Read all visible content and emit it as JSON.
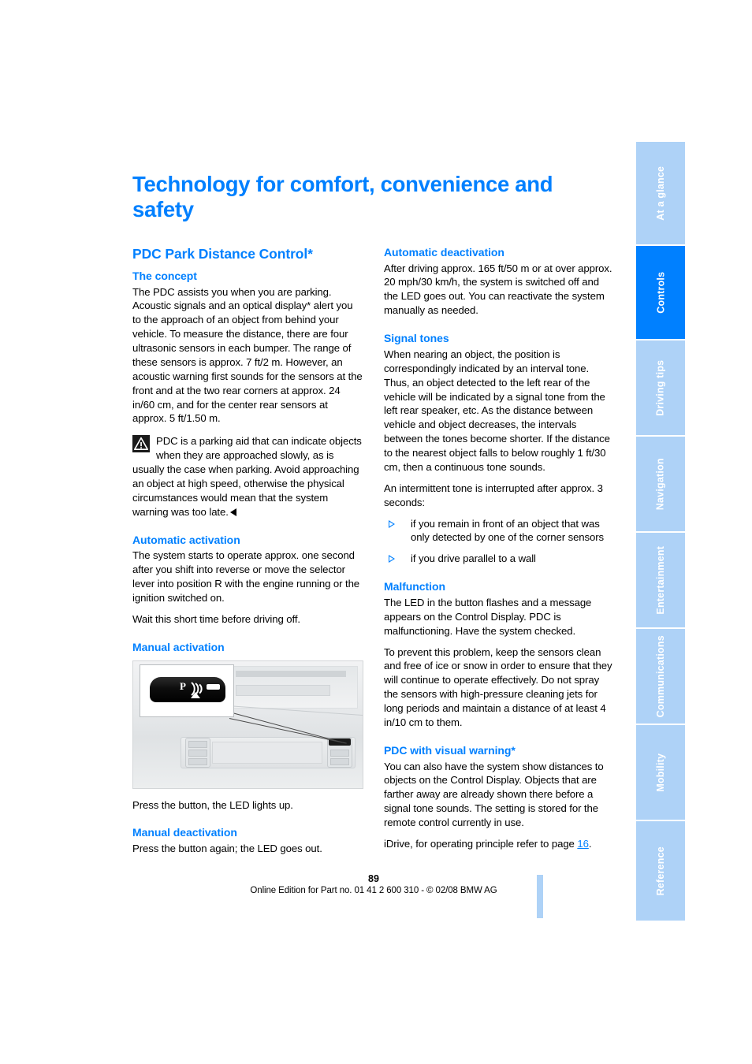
{
  "page": {
    "title": "Technology for comfort, convenience and safety",
    "number": "89",
    "footer_text": "Online Edition for Part no. 01 41 2 600 310 - © 02/08 BMW AG",
    "accent_blue": "#0080ff",
    "tab_inactive_blue": "#aed2f7"
  },
  "tabs": [
    {
      "label": "At a glance",
      "active": false
    },
    {
      "label": "Controls",
      "active": true
    },
    {
      "label": "Driving tips",
      "active": false
    },
    {
      "label": "Navigation",
      "active": false
    },
    {
      "label": "Entertainment",
      "active": false
    },
    {
      "label": "Communications",
      "active": false
    },
    {
      "label": "Mobility",
      "active": false
    },
    {
      "label": "Reference",
      "active": false
    }
  ],
  "left_column": {
    "section_title": "PDC Park Distance Control*",
    "concept": {
      "heading": "The concept",
      "paragraph": "The PDC assists you when you are parking. Acoustic signals and an optical display* alert you to the approach of an object from behind your vehicle. To measure the distance, there are four ultrasonic sensors in each bumper. The range of these sensors is approx. 7 ft/2 m. However, an acoustic warning first sounds for the sensors at the front and at the two rear corners at approx. 24 in/60 cm, and for the center rear sensors at approx. 5 ft/1.50 m."
    },
    "warning": {
      "icon": "warning-triangle-icon",
      "text": "PDC is a parking aid that can indicate objects when they are approached slowly, as is usually the case when parking. Avoid approaching an object at high speed, otherwise the physical circumstances would mean that the system warning was too late."
    },
    "automatic_activation": {
      "heading": "Automatic activation",
      "paragraph1": "The system starts to operate approx. one second after you shift into reverse or move the selector lever into position R with the engine running or the ignition switched on.",
      "paragraph2": "Wait this short time before driving off."
    },
    "manual_activation": {
      "heading": "Manual activation",
      "figure": {
        "alt": "Center console with PDC button highlighted",
        "button_glyph": "P",
        "code": "dcbmwa41"
      },
      "caption": "Press the button, the LED lights up."
    },
    "manual_deactivation": {
      "heading": "Manual deactivation",
      "paragraph": "Press the button again; the LED goes out."
    }
  },
  "right_column": {
    "automatic_deactivation": {
      "heading": "Automatic deactivation",
      "paragraph": "After driving approx. 165 ft/50 m or at over approx. 20 mph/30 km/h, the system is switched off and the LED goes out. You can reactivate the system manually as needed."
    },
    "signal_tones": {
      "heading": "Signal tones",
      "paragraph1": "When nearing an object, the position is correspondingly indicated by an interval tone. Thus, an object detected to the left rear of the vehicle will be indicated by a signal tone from the left rear speaker, etc. As the distance between vehicle and object decreases, the intervals between the tones become shorter. If the distance to the nearest object falls to below roughly 1 ft/30 cm, then a continuous tone sounds.",
      "paragraph2": "An intermittent tone is interrupted after approx. 3 seconds:",
      "bullets": [
        "if you remain in front of an object that was only detected by one of the corner sensors",
        "if you drive parallel to a wall"
      ]
    },
    "malfunction": {
      "heading": "Malfunction",
      "paragraph1": "The LED in the button flashes and a message appears on the Control Display. PDC is malfunctioning. Have the system checked.",
      "paragraph2": "To prevent this problem, keep the sensors clean and free of ice or snow in order to ensure that they will continue to operate effectively. Do not spray the sensors with high-pressure cleaning jets for long periods and maintain a distance of at least 4 in/10 cm to them."
    },
    "visual_warning": {
      "heading": "PDC with visual warning*",
      "paragraph": "You can also have the system show distances to objects on the Control Display. Objects that are farther away are already shown there before a signal tone sounds. The setting is stored for the remote control currently in use.",
      "cross_ref_prefix": "iDrive, for operating principle refer to page ",
      "cross_ref_page": "16",
      "cross_ref_suffix": "."
    }
  }
}
